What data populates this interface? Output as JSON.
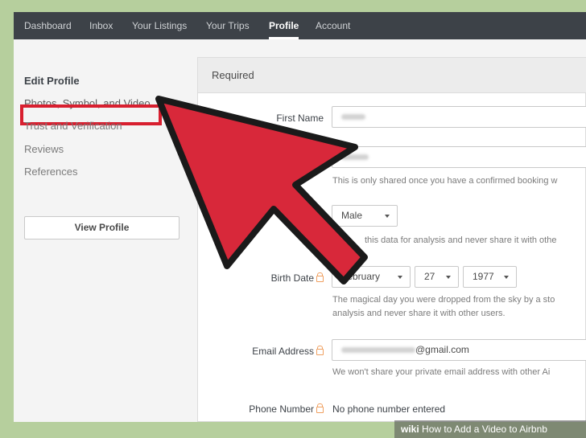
{
  "nav": {
    "items": [
      "Dashboard",
      "Inbox",
      "Your Listings",
      "Your Trips",
      "Profile",
      "Account"
    ],
    "active": "Profile"
  },
  "sidebar": {
    "items": [
      "Edit Profile",
      "Photos, Symbol, and Video",
      "Trust and Verification",
      "Reviews",
      "References"
    ],
    "view_profile": "View Profile"
  },
  "panel": {
    "header": "Required",
    "first_name_label": "First Name",
    "last_name_hint": "This is only shared once you have a confirmed booking w",
    "gender_value": "Male",
    "gender_hint": "this data for analysis and never share it with othe",
    "birth_date_label": "Birth Date",
    "birth_month": "February",
    "birth_day": "27",
    "birth_year": "1977",
    "birth_hint_1": "The magical day you were dropped from the sky by a sto",
    "birth_hint_2": "analysis and never share it with other users.",
    "email_label": "Email Address",
    "email_suffix": "@gmail.com",
    "email_hint": "We won't share your private email address with other Ai",
    "phone_label": "Phone Number",
    "phone_value": "No phone number entered"
  },
  "watermark": {
    "brand": "wiki",
    "text": "How to Add a Video to Airbnb"
  },
  "colors": {
    "nav_bg": "#3d4248",
    "arrow_red": "#d8283a",
    "highlight": "#d81f2f",
    "page_border": "#b6cf9d"
  }
}
